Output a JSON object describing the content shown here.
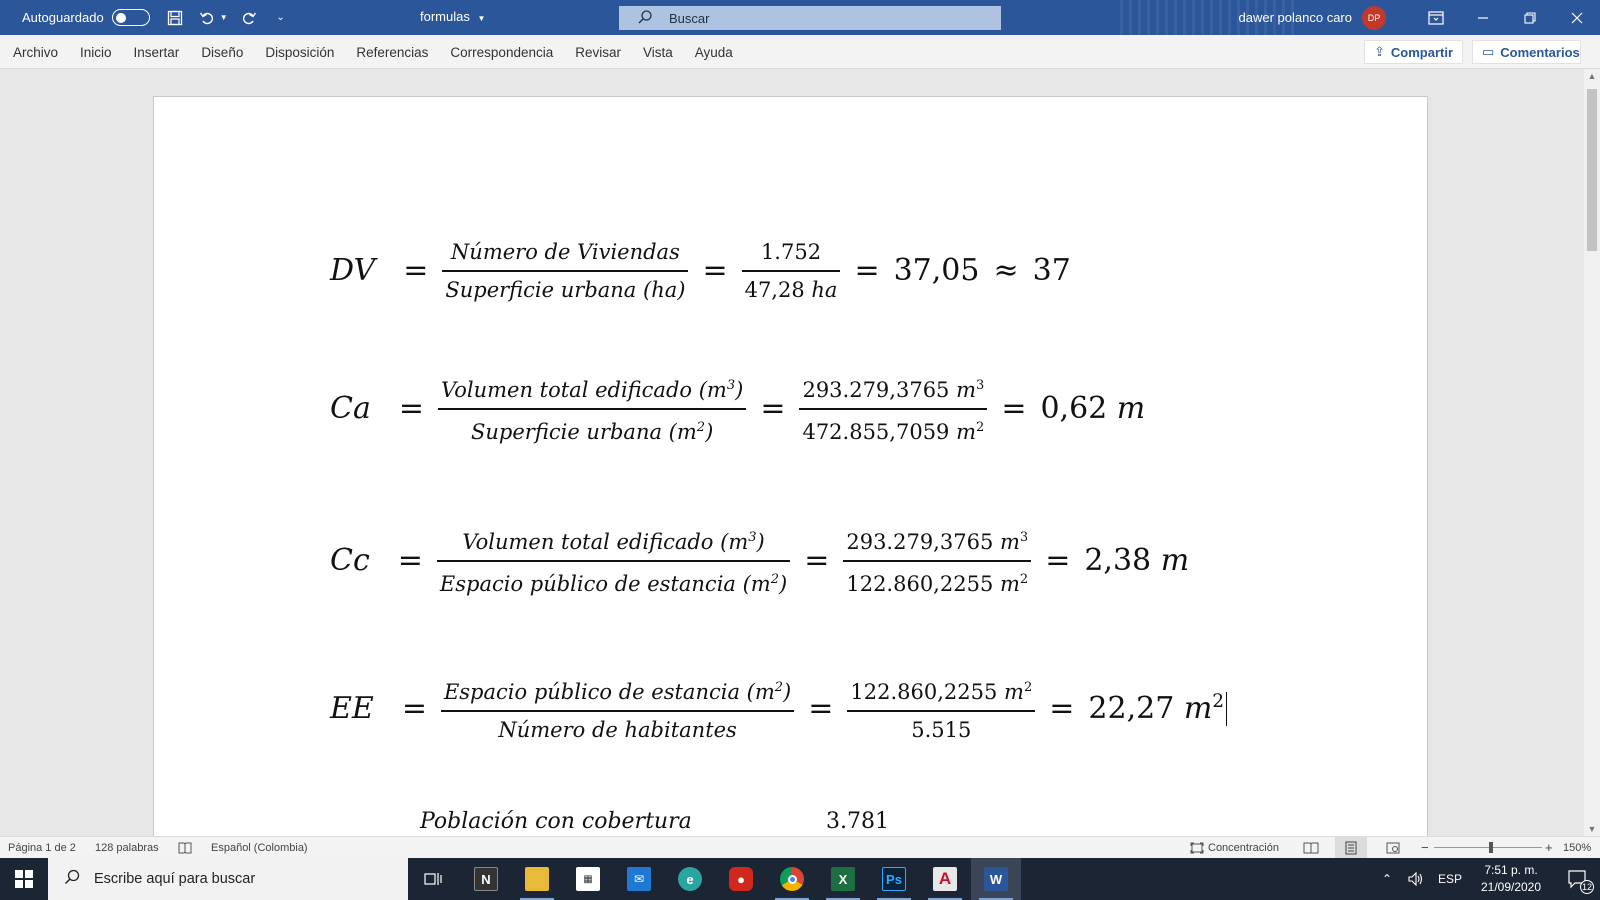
{
  "titlebar": {
    "autosave_label": "Autoguardado",
    "doc_title": "formulas",
    "search_placeholder": "Buscar",
    "user_name": "dawer polanco caro",
    "user_initials": "DP"
  },
  "menu": {
    "items": [
      "Archivo",
      "Inicio",
      "Insertar",
      "Diseño",
      "Disposición",
      "Referencias",
      "Correspondencia",
      "Revisar",
      "Vista",
      "Ayuda"
    ],
    "share_label": "Compartir",
    "comments_label": "Comentarios"
  },
  "document": {
    "eq1": {
      "lhs": "DV",
      "num1": "Número de Viviendas",
      "den1": "Superficie urbana (ha)",
      "num2": "1.752",
      "den2_value": "47,28",
      "den2_unit": "ha",
      "result": "37,05",
      "approx": "37"
    },
    "eq2": {
      "lhs": "Ca",
      "num1": "Volumen total edificado (m",
      "den1": "Superficie urbana (m",
      "num2_value": "293.279,3765",
      "den2_value": "472.855,7059",
      "result_value": "0,62",
      "unit": "m"
    },
    "eq3": {
      "lhs": "Cc",
      "num1": "Volumen total edificado (m",
      "den1": "Espacio público de estancia (m",
      "num2_value": "293.279,3765",
      "den2_value": "122.860,2255",
      "result_value": "2,38",
      "unit": "m"
    },
    "eq4": {
      "lhs": "EE",
      "num1": "Espacio público de estancia (m",
      "den1": "Número de habitantes",
      "num2_value": "122.860,2255",
      "den2": "5.515",
      "result_value": "22,27",
      "unit": "m"
    },
    "cut_text": "Población con cobertura",
    "cut_value": "3.781"
  },
  "statusbar": {
    "page": "Página 1 de 2",
    "words": "128 palabras",
    "language": "Español (Colombia)",
    "focus": "Concentración",
    "zoom": "150%"
  },
  "taskbar": {
    "search_placeholder": "Escribe aquí para buscar",
    "language": "ESP",
    "time": "7:51 p. m.",
    "date": "21/09/2020",
    "notifications": "12"
  }
}
